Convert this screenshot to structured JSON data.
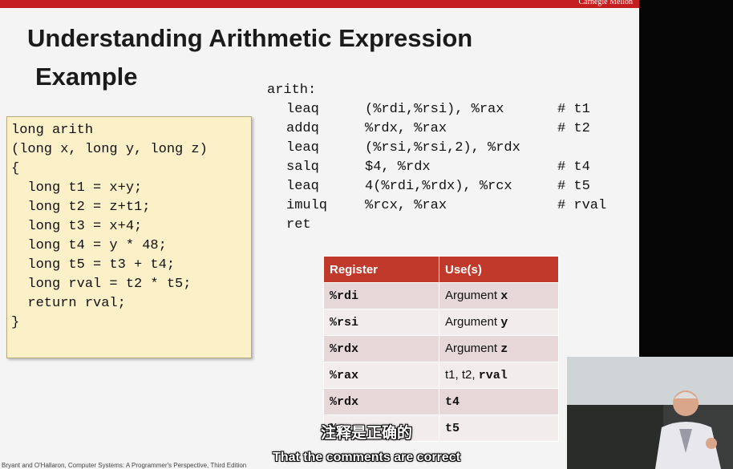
{
  "header": {
    "brand": "Carnegie Mellon"
  },
  "slide": {
    "title_line1": "Understanding Arithmetic Expression",
    "title_line2": "Example",
    "c_code": [
      "long arith",
      "(long x, long y, long z)",
      "{",
      "  long t1 = x+y;",
      "  long t2 = z+t1;",
      "  long t3 = x+4;",
      "  long t4 = y * 48;",
      "  long t5 = t3 + t4;",
      "  long rval = t2 * t5;",
      "  return rval;",
      "}"
    ],
    "asm_label": "arith:",
    "asm": [
      {
        "op": "leaq",
        "args": "(%rdi,%rsi), %rax",
        "comment": "# t1"
      },
      {
        "op": "addq",
        "args": "%rdx, %rax",
        "comment": "# t2"
      },
      {
        "op": "leaq",
        "args": "(%rsi,%rsi,2), %rdx",
        "comment": ""
      },
      {
        "op": "salq",
        "args": "$4, %rdx",
        "comment": "# t4"
      },
      {
        "op": "leaq",
        "args": "4(%rdi,%rdx), %rcx",
        "comment": "# t5"
      },
      {
        "op": "imulq",
        "args": "%rcx, %rax",
        "comment": "# rval"
      },
      {
        "op": "ret",
        "args": "",
        "comment": ""
      }
    ],
    "table": {
      "headers": [
        "Register",
        "Use(s)"
      ],
      "rows": [
        {
          "reg": "%rdi",
          "use_text": "Argument ",
          "use_code": "x"
        },
        {
          "reg": "%rsi",
          "use_text": "Argument ",
          "use_code": "y"
        },
        {
          "reg": "%rdx",
          "use_text": "Argument ",
          "use_code": "z"
        },
        {
          "reg": "%rax",
          "use_text": "t1, t2, ",
          "use_code": "rval"
        },
        {
          "reg": "%rdx",
          "use_text": "",
          "use_code": "t4"
        },
        {
          "reg": "%rcx",
          "use_text": "",
          "use_code": "t5"
        }
      ]
    },
    "footer": "Bryant and O'Hallaron, Computer Systems: A Programmer's Perspective, Third Edition"
  },
  "subtitles": {
    "cn": "注释是正确的",
    "en": "That the comments are correct"
  },
  "colors": {
    "accent_red": "#c41e1e",
    "header_red": "#c1392b",
    "code_bg": "#fbf0c7"
  }
}
